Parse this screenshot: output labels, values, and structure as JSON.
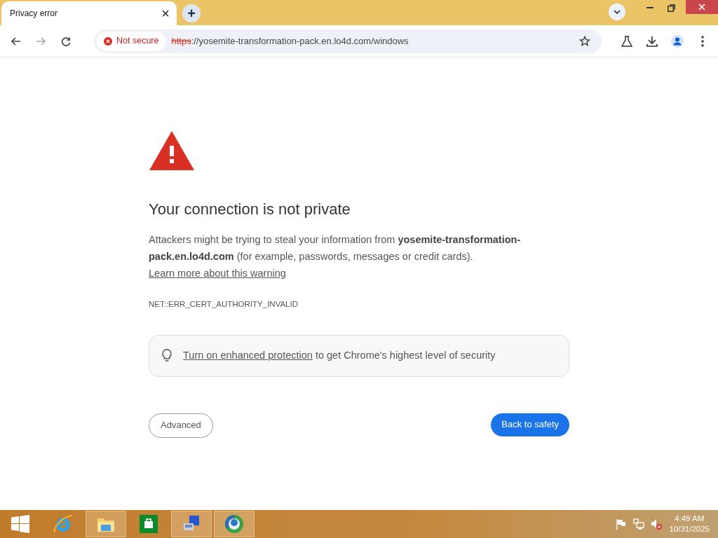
{
  "tab": {
    "title": "Privacy error",
    "close": "×",
    "selected": true
  },
  "new_tab": "+",
  "address_bar": {
    "security_label": "Not secure",
    "scheme": "https",
    "rest": "://yosemite-transformation-pack.en.lo4d.com/windows"
  },
  "page": {
    "heading": "Your connection is not private",
    "body": "Attackers might be trying to steal your information from **yosemite-transformation-pack.en.lo4d.com** (for example, passwords, messages or credit cards).",
    "learn_more_link": "Learn more about this warning",
    "error_code": "NET::ERR_CERT_AUTHORITY_INVALID",
    "protection_link": "Turn on enhanced protection",
    "protection_text": " to get Chrome's highest level of security",
    "advanced_button": "Advanced",
    "back_button": "Back to safety"
  },
  "taskbar": {
    "apps": [
      {
        "kind": "ie",
        "running": false
      },
      {
        "kind": "folder",
        "running": true
      },
      {
        "kind": "store",
        "running": false
      },
      {
        "kind": "computer",
        "running": true
      },
      {
        "kind": "browser",
        "running": true
      }
    ],
    "time": "4:49 AM",
    "date": "10/31/2025"
  }
}
